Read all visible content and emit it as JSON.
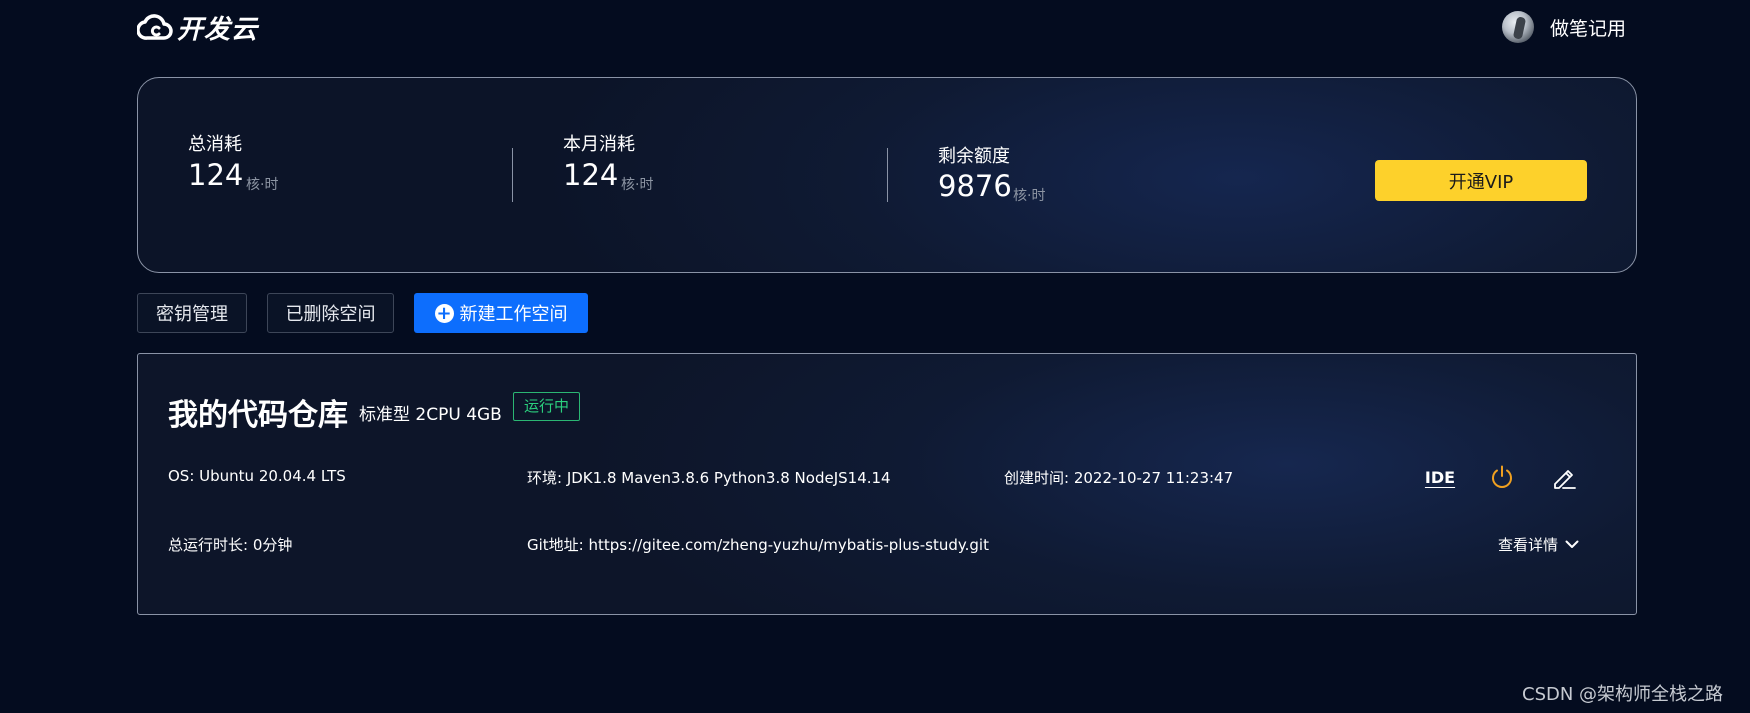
{
  "header": {
    "logo_text": "开发云",
    "logo_icon": "cloud-icon",
    "user_name": "做笔记用"
  },
  "stats": [
    {
      "label": "总消耗",
      "value": "124",
      "unit": "核·时"
    },
    {
      "label": "本月消耗",
      "value": "124",
      "unit": "核·时"
    },
    {
      "label": "剩余额度",
      "value": "9876",
      "unit": "核·时"
    }
  ],
  "vip_button": "开通VIP",
  "actions": {
    "key_management": "密钥管理",
    "deleted_spaces": "已删除空间",
    "new_workspace": "新建工作空间"
  },
  "workspace": {
    "name": "我的代码仓库",
    "spec": "标准型 2CPU 4GB",
    "status": "运行中",
    "os": "OS: Ubuntu 20.04.4 LTS",
    "env": "环境: JDK1.8 Maven3.8.6 Python3.8 NodeJS14.14",
    "created": "创建时间: 2022-10-27 11:23:47",
    "runtime": "总运行时长: 0分钟",
    "git": "Git地址: https://gitee.com/zheng-yuzhu/mybatis-plus-study.git",
    "ide_label": "IDE",
    "details_label": "查看详情"
  },
  "watermark": "CSDN @架构师全栈之路",
  "colors": {
    "background": "#040c1f",
    "vip": "#fdd12b",
    "primary": "#0d6efd",
    "status_green": "#2bd07e",
    "power_orange": "#f0a020"
  }
}
